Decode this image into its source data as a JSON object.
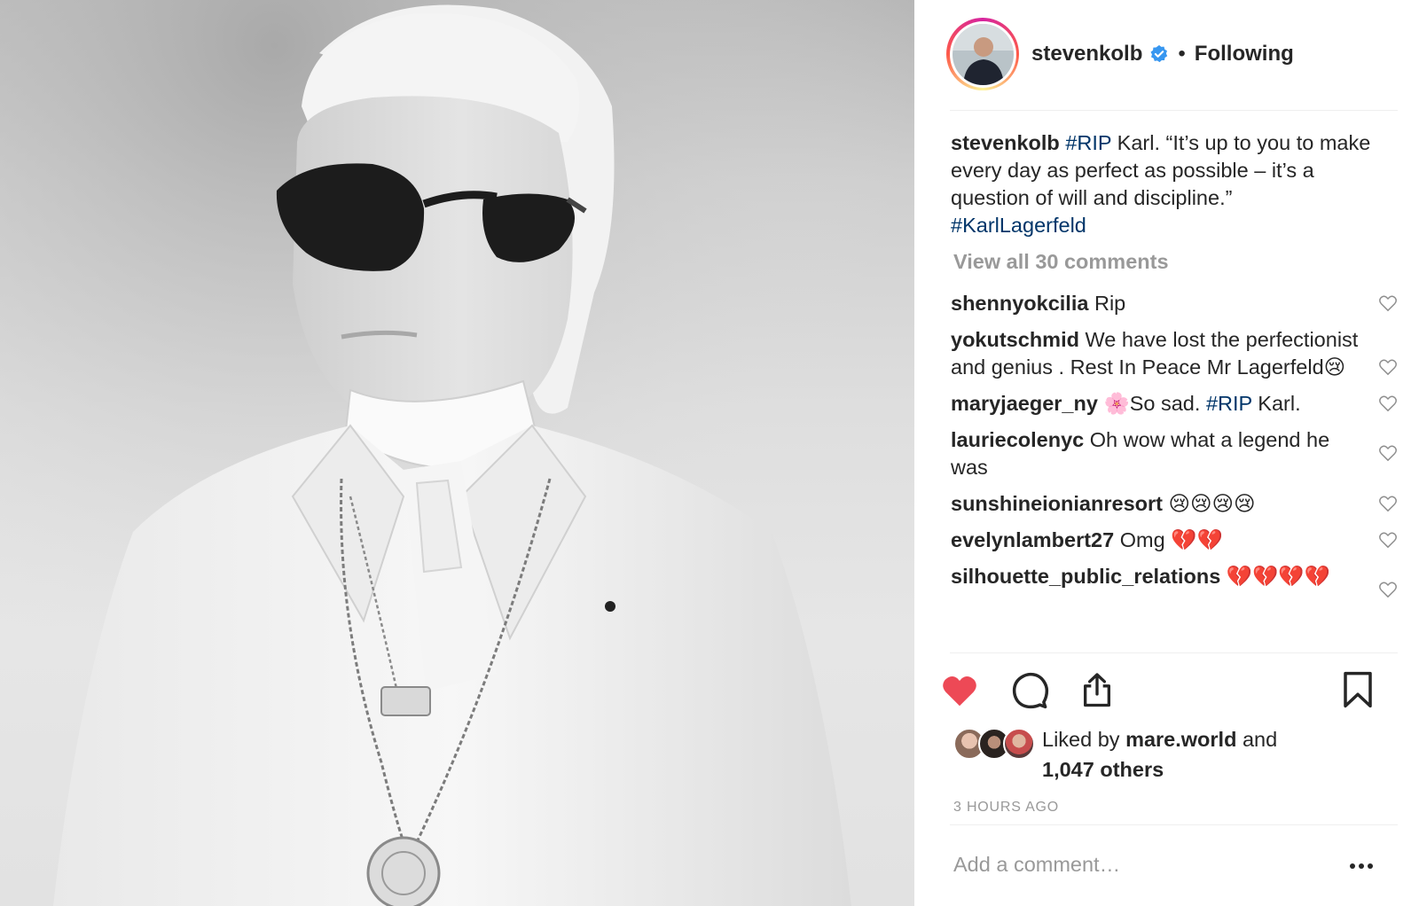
{
  "post": {
    "username": "stevenkolb",
    "verified": true,
    "follow_separator": "•",
    "follow_status": "Following"
  },
  "caption": {
    "username": "stevenkolb",
    "hashtag_1": "#RIP",
    "text_1": " Karl. “It’s up to you to make every day as perfect as possible – it’s a question of will and discipline.”",
    "hashtag_2": "#KarlLagerfeld"
  },
  "view_all_comments": "View all 30 comments",
  "comments": [
    {
      "username": "shennyokcilia",
      "text": " Rip"
    },
    {
      "username": "yokutschmid",
      "text": " We have lost the perfectionist and genius . Rest In Peace Mr Lagerfeld",
      "emoji": "😢"
    },
    {
      "username": "maryjaeger_ny",
      "emoji_lead": " 🌸",
      "text": "So sad. ",
      "hashtag": "#RIP",
      "text_after": " Karl."
    },
    {
      "username": "lauriecolenyc",
      "text": " Oh wow what a legend he was"
    },
    {
      "username": "sunshineionianresort",
      "emoji": " 😢😢😢😢"
    },
    {
      "username": "evelynlambert27",
      "text": " Omg ",
      "emoji": "💔💔"
    },
    {
      "username": "silhouette_public_relations",
      "emoji": " 💔💔💔💔"
    }
  ],
  "actions": {
    "like": "heart-filled-icon",
    "comment": "comment-bubble-icon",
    "share": "share-icon",
    "save": "bookmark-icon"
  },
  "likes": {
    "prefix": "Liked by ",
    "user": "mare.world",
    "middle": " and",
    "others": "1,047 others"
  },
  "timestamp": "3 HOURS AGO",
  "add_comment_placeholder": "Add a comment…",
  "colors": {
    "link_blue": "#003569",
    "like_red": "#ed4956",
    "verified_blue": "#3897f0",
    "muted_gray": "#999999"
  }
}
